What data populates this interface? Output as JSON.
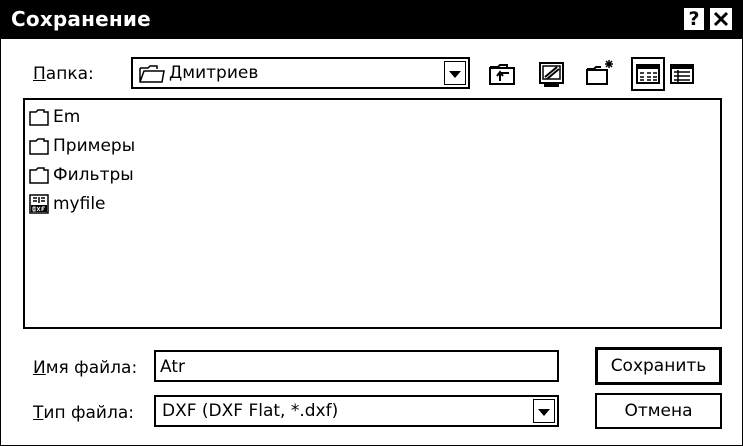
{
  "dialog": {
    "title": "Сохранение",
    "help_label": "?",
    "close_label": "✕"
  },
  "folder": {
    "label": "Папка:",
    "value": "Дмитриев"
  },
  "toolbar": {
    "icons": [
      "up-folder-icon",
      "desktop-icon",
      "new-folder-icon",
      "list-view-icon",
      "details-view-icon"
    ]
  },
  "files": [
    {
      "name": "Em",
      "icon": "folder-icon"
    },
    {
      "name": "Примеры",
      "icon": "folder-icon"
    },
    {
      "name": "Фильтры",
      "icon": "folder-icon"
    },
    {
      "name": "myfile",
      "icon": "dxf-file-icon"
    }
  ],
  "filename": {
    "label": "Имя файла:",
    "value": "Atr"
  },
  "filetype": {
    "label": "Тип файла:",
    "value": "DXF (DXF Flat, *.dxf)"
  },
  "buttons": {
    "save": "Сохранить",
    "cancel": "Отмена"
  }
}
